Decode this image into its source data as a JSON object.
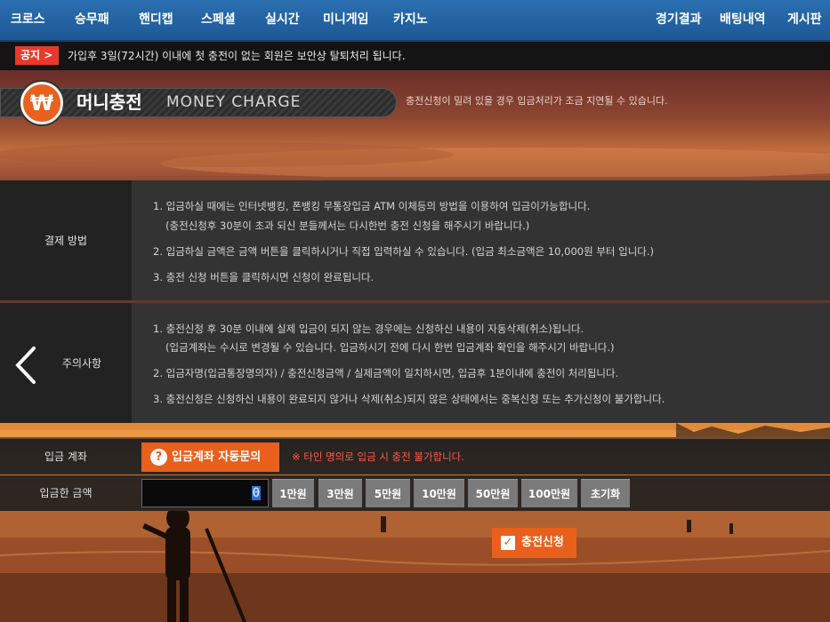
{
  "nav": {
    "left": [
      "크로스",
      "승무패",
      "핸디캡",
      "스페셜",
      "실시간",
      "미니게임",
      "카지노"
    ],
    "right": [
      "경기결과",
      "배팅내역",
      "게시판"
    ]
  },
  "notice": {
    "badge": "공지 >",
    "text": "가입후 3일(72시간) 이내에 첫 충전이 없는 회원은 보안상 탈퇴처리 됩니다."
  },
  "header": {
    "icon_symbol": "₩",
    "title_ko": "머니충전",
    "title_en": "MONEY CHARGE",
    "note": "충전신청이 밀려 있을 경우 입금처리가 조금 지연될 수 있습니다."
  },
  "payment": {
    "label": "결제 방법",
    "lines": [
      "1. 입금하실 때에는 인터넷뱅킹, 폰뱅킹 무통장입금 ATM 이체등의 방법을 이용하여 입금이가능합니다.",
      "(충전신청후 30분이 초과 되신 분들께서는 다시한번 충전 신청을 해주시기 바랍니다.)",
      "2. 입금하실 금액은 금액 버튼을 클릭하시거나 직접 입력하실 수 있습니다. (입금 최소금액은 10,000원 부터 입니다.)",
      "3. 충전 신청 버튼을 클릭하시면 신청이 완료됩니다."
    ]
  },
  "caution": {
    "label": "주의사항",
    "lines": [
      "1. 충전신청 후 30분 이내에 실제 입금이 되지 않는 경우에는 신청하신 내용이 자동삭제(취소)됩니다.",
      "(입금계좌는 수시로 변경될 수 있습니다. 입금하시기 전에 다시 한번 입금계좌 확인을 해주시기 바랍니다.)",
      "2. 입금자명(입금통장명의자) / 충전신청금액 / 실제금액이 일치하시면, 입금후 1분이내에 충전이 처리됩니다.",
      "3. 충전신청은 신청하신 내용이 완료되지 않거나 삭제(취소)되지 않은 상태에서는 중복신청 또는 추가신청이 불가합니다."
    ]
  },
  "account_row": {
    "label": "입금 계좌",
    "button": "입금계좌 자동문의",
    "button_icon": "?",
    "warning": "※ 타인 명의로 입금 시 충전 불가합니다."
  },
  "amount_row": {
    "label": "입금한 금액",
    "value": "0",
    "buttons": [
      "1만원",
      "3만원",
      "5만원",
      "10만원",
      "50만원",
      "100만원",
      "초기화"
    ]
  },
  "submit": {
    "label": "충전신청",
    "check": "✓"
  }
}
